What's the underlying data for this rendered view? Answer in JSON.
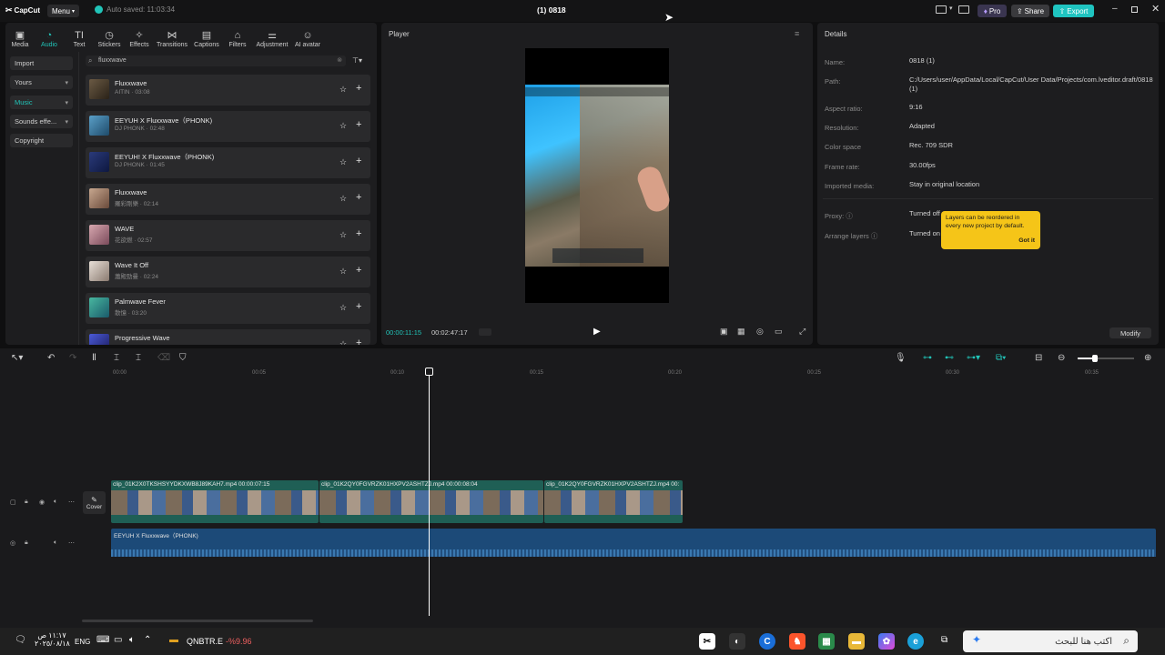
{
  "titlebar": {
    "logo": "CapCut",
    "menu_label": "Menu",
    "autosave": "Auto saved: 11:03:34",
    "project_title": "(1) 0818",
    "pro_label": "Pro",
    "share_label": "Share",
    "export_label": "Export"
  },
  "tool_tabs": [
    {
      "label": "Media",
      "icon": "media-icon"
    },
    {
      "label": "Audio",
      "icon": "audio-icon"
    },
    {
      "label": "Text",
      "icon": "text-icon"
    },
    {
      "label": "Stickers",
      "icon": "sticker-icon"
    },
    {
      "label": "Effects",
      "icon": "effects-icon"
    },
    {
      "label": "Transitions",
      "icon": "transitions-icon"
    },
    {
      "label": "Captions",
      "icon": "captions-icon"
    },
    {
      "label": "Filters",
      "icon": "filters-icon"
    },
    {
      "label": "Adjustment",
      "icon": "adjustment-icon"
    },
    {
      "label": "AI avatar",
      "icon": "avatar-icon"
    }
  ],
  "sidebar": {
    "items": [
      "Import",
      "Yours",
      "Music",
      "Sounds effe...",
      "Copyright"
    ]
  },
  "search": {
    "value": "fluxxwave"
  },
  "tracks": [
    {
      "name": "Fluxxwave",
      "meta": "AITIN · 03:08"
    },
    {
      "name": "EEYUH X Fluxxwave（PHONK)",
      "meta": "DJ PHONK · 02:48"
    },
    {
      "name": "EEYUH! X Fluxxwave（PHONK)",
      "meta": "DJ PHONK · 01:45"
    },
    {
      "name": "Fluxxwave",
      "meta": "羅彩剛樂 · 02:14"
    },
    {
      "name": "WAVE",
      "meta": "花欲燃 · 02:57"
    },
    {
      "name": "Wave It Off",
      "meta": "蕭殿勁曼 · 02:24"
    },
    {
      "name": "Palmwave Fever",
      "meta": "散憶 · 03:20"
    },
    {
      "name": "Progressive Wave",
      "meta": ""
    }
  ],
  "player": {
    "header": "Player",
    "current_time": "00:00:11:15",
    "total_time": "00:02:47:17"
  },
  "details": {
    "header": "Details",
    "rows": [
      {
        "label": "Name:",
        "value": "0818 (1)"
      },
      {
        "label": "Path:",
        "value": "C:/Users/user/AppData/Local/CapCut/User Data/Projects/com.lveditor.draft/0818 (1)"
      },
      {
        "label": "Aspect ratio:",
        "value": "9:16"
      },
      {
        "label": "Resolution:",
        "value": "Adapted"
      },
      {
        "label": "Color space",
        "value": "Rec. 709 SDR"
      },
      {
        "label": "Frame rate:",
        "value": "30.00fps"
      },
      {
        "label": "Imported media:",
        "value": "Stay in original location"
      },
      {
        "label": "Proxy:",
        "value": "Turned off"
      },
      {
        "label": "Arrange layers",
        "value": "Turned on"
      }
    ],
    "tooltip_text": "Layers can be reordered in every new project by default.",
    "tooltip_button": "Got it",
    "modify_label": "Modify"
  },
  "timeline": {
    "ticks": [
      "00:00",
      "00:05",
      "00:10",
      "00:15",
      "00:20",
      "00:25",
      "00:30",
      "00:35"
    ],
    "clips": [
      {
        "label": "clip_01K2X0TKSHSYYDKXWB8J89KAH7.mp4  00:00:07:15"
      },
      {
        "label": "clip_01K2QY0FGVRZK01HXPV2ASHTZJ.mp4  00:00:08:04"
      },
      {
        "label": "clip_01K2QY0FGVRZK01HXPV2ASHTZJ.mp4  00:"
      }
    ],
    "audio_label": "EEYUH X Fluxxwave（PHONK)",
    "cover_label": "Cover"
  },
  "taskbar": {
    "time": "١١:١٧ ص",
    "date": "٢٠٢٥/٠٨/١٨",
    "lang": "ENG",
    "stock_name": "QNBTR.E",
    "stock_change": "-%9.96",
    "search_placeholder": "اكتب هنا للبحث"
  }
}
